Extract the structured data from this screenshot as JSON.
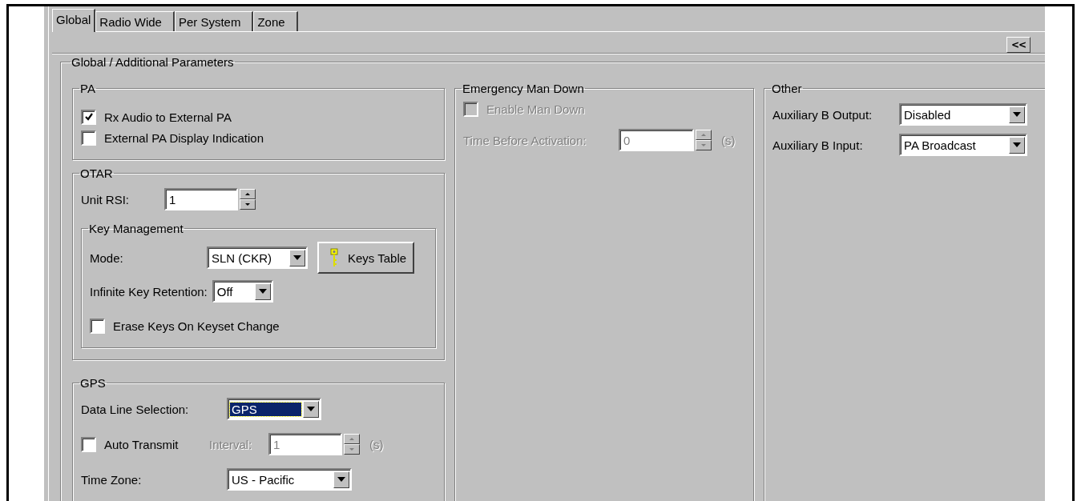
{
  "tabs": [
    {
      "label": "Global",
      "selected": true
    },
    {
      "label": "Radio Wide",
      "selected": false
    },
    {
      "label": "Per System",
      "selected": false
    },
    {
      "label": "Zone",
      "selected": false
    }
  ],
  "collapse_button": "<<",
  "parameters": {
    "title": "Global / Additional Parameters",
    "pa": {
      "title": "PA",
      "options": [
        {
          "label": "Rx Audio to External PA",
          "checked": true
        },
        {
          "label": "External PA Display Indication",
          "checked": false
        }
      ]
    },
    "otar": {
      "title": "OTAR",
      "unit_rsi": {
        "label": "Unit RSI:",
        "value": "1"
      },
      "key_management": {
        "title": "Key Management",
        "mode": {
          "label": "Mode:",
          "value": "SLN (CKR)"
        },
        "keys_table_button": "Keys Table",
        "infinite_key_retention": {
          "label": "Infinite Key Retention:",
          "value": "Off"
        },
        "erase_keys": {
          "label": "Erase Keys On Keyset Change",
          "checked": false
        }
      }
    },
    "gps": {
      "title": "GPS",
      "data_line_selection": {
        "label": "Data Line Selection:",
        "value": "GPS",
        "focused": true
      },
      "auto_transmit": {
        "label": "Auto Transmit",
        "checked": false
      },
      "interval": {
        "label": "Interval:",
        "value": "1",
        "unit": "(s)",
        "disabled": true
      },
      "time_zone": {
        "label": "Time Zone:",
        "value": "US - Pacific"
      }
    },
    "emergency_man_down": {
      "title": "Emergency Man Down",
      "enable": {
        "label": "Enable Man Down",
        "checked": false,
        "disabled": true
      },
      "time_before_activation": {
        "label": "Time Before Activation:",
        "value": "0",
        "unit": "(s)",
        "disabled": true
      }
    },
    "other": {
      "title": "Other",
      "fields": [
        {
          "label": "Auxiliary B Output:",
          "value": "Disabled"
        },
        {
          "label": "Auxiliary B Input:",
          "value": "PA Broadcast"
        }
      ]
    }
  }
}
